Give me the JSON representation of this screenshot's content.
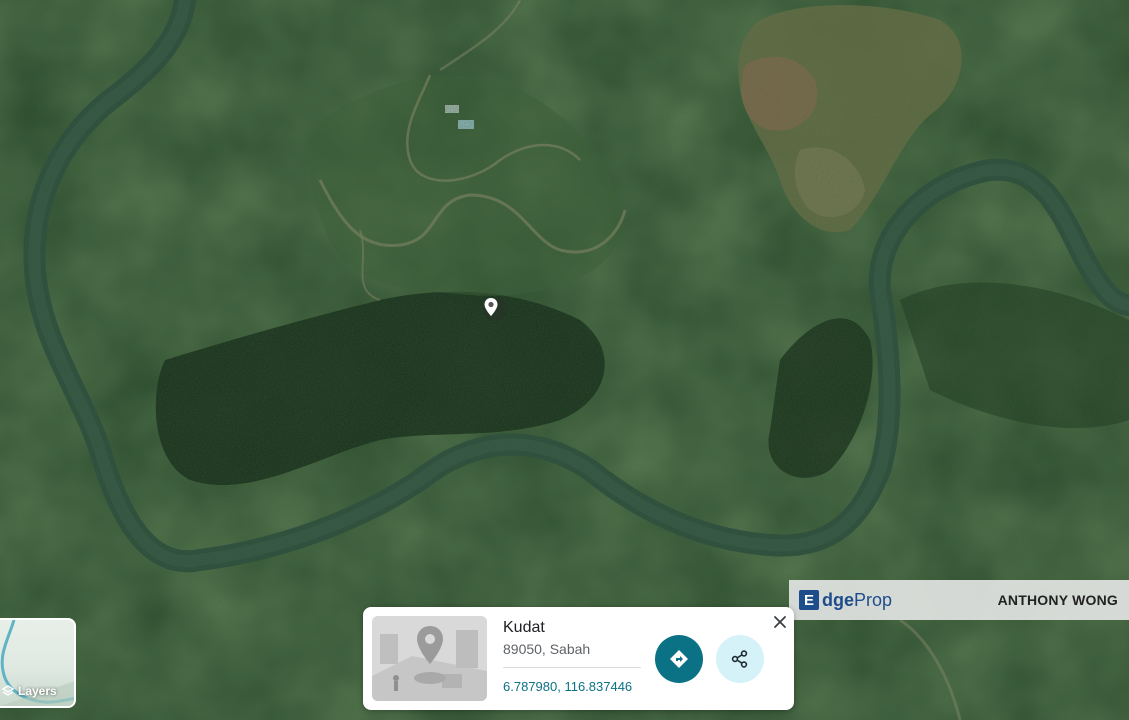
{
  "map": {
    "type": "satellite",
    "location_pin": "location-pin-icon"
  },
  "watermark": {
    "logo_letter": "E",
    "logo_edge": "dge",
    "logo_prop": "Prop",
    "agent_name": "ANTHONY WONG"
  },
  "layers_button": {
    "label": "Layers",
    "icon": "layers-icon"
  },
  "place_card": {
    "name": "Kudat",
    "address": "89050, Sabah",
    "coordinates": "6.787980, 116.837446",
    "directions_icon": "directions-icon",
    "share_icon": "share-icon",
    "close_icon": "close-icon"
  },
  "colors": {
    "accent": "#0b7285",
    "share_bg": "#d4f2f8",
    "river": "#2c4d3c",
    "forest": "#27452a"
  }
}
